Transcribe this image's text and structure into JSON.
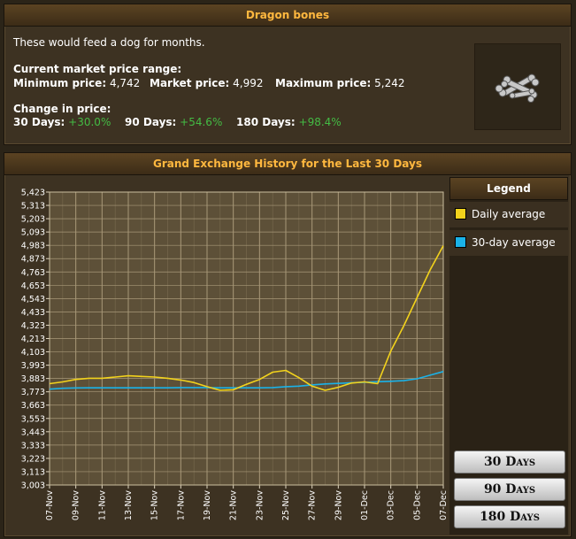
{
  "item": {
    "name": "Dragon bones",
    "examine": "These would feed a dog for months.",
    "price_heading": "Current market price range:",
    "min_label": "Minimum price:",
    "min_value": "4,742",
    "market_label": "Market price:",
    "market_value": "4,992",
    "max_label": "Maximum price:",
    "max_value": "5,242",
    "change_heading": "Change in price:",
    "change_30_label": "30 Days:",
    "change_30_value": "+30.0%",
    "change_90_label": "90 Days:",
    "change_90_value": "+54.6%",
    "change_180_label": "180 Days:",
    "change_180_value": "+98.4%",
    "icon": "dragon-bones-icon"
  },
  "graph": {
    "title": "Grand Exchange History for the Last 30 Days"
  },
  "legend": {
    "title": "Legend",
    "daily_label": "Daily average",
    "avg_label": "30-day average"
  },
  "buttons": {
    "days30": "30 Days",
    "days90": "90 Days",
    "days180": "180 Days"
  },
  "colors": {
    "daily": "#f2d21c",
    "avg": "#1ab2e8",
    "plot_bg": "#5d5038",
    "grid": "#a89878",
    "heading": "#ffb83f",
    "positive": "#44bb44"
  },
  "chart_data": {
    "type": "line",
    "ylim": [
      3003,
      5423
    ],
    "y_ticks": [
      "3,003",
      "3,113",
      "3,223",
      "3,333",
      "3,443",
      "3,553",
      "3,663",
      "3,773",
      "3,883",
      "3,993",
      "4,103",
      "4,213",
      "4,323",
      "4,433",
      "4,543",
      "4,653",
      "4,763",
      "4,873",
      "4,983",
      "5,093",
      "5,203",
      "5,313",
      "5,423"
    ],
    "x_tick_labels": [
      "07-Nov",
      "09-Nov",
      "11-Nov",
      "13-Nov",
      "15-Nov",
      "17-Nov",
      "19-Nov",
      "21-Nov",
      "23-Nov",
      "25-Nov",
      "27-Nov",
      "29-Nov",
      "01-Dec",
      "03-Dec",
      "05-Dec",
      "07-Dec"
    ],
    "x": [
      "07-Nov",
      "08-Nov",
      "09-Nov",
      "10-Nov",
      "11-Nov",
      "12-Nov",
      "13-Nov",
      "14-Nov",
      "15-Nov",
      "16-Nov",
      "17-Nov",
      "18-Nov",
      "19-Nov",
      "20-Nov",
      "21-Nov",
      "22-Nov",
      "23-Nov",
      "24-Nov",
      "25-Nov",
      "26-Nov",
      "27-Nov",
      "28-Nov",
      "29-Nov",
      "30-Nov",
      "01-Dec",
      "02-Dec",
      "03-Dec",
      "04-Dec",
      "05-Dec",
      "06-Dec",
      "07-Dec"
    ],
    "series": [
      {
        "name": "Daily average",
        "values": [
          3840,
          3855,
          3875,
          3885,
          3885,
          3895,
          3905,
          3900,
          3895,
          3885,
          3870,
          3850,
          3815,
          3785,
          3790,
          3835,
          3875,
          3935,
          3950,
          3890,
          3820,
          3785,
          3810,
          3845,
          3855,
          3840,
          4110,
          4320,
          4550,
          4780,
          4980
        ]
      },
      {
        "name": "30-day average",
        "values": [
          3795,
          3802,
          3805,
          3806,
          3806,
          3806,
          3806,
          3806,
          3806,
          3806,
          3808,
          3808,
          3808,
          3806,
          3806,
          3806,
          3806,
          3808,
          3815,
          3820,
          3830,
          3838,
          3842,
          3848,
          3852,
          3856,
          3860,
          3865,
          3880,
          3910,
          3940
        ]
      }
    ],
    "grid": true,
    "legend_position": "right"
  }
}
